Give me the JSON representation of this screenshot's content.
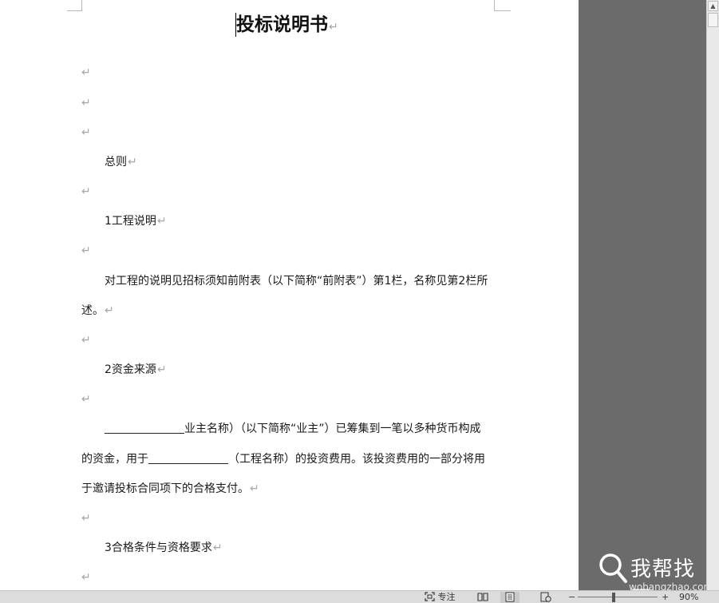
{
  "document": {
    "title": "投标说明书",
    "para_mark": "↵",
    "section_general": "总则",
    "item1_heading": "1工程说明",
    "item1_text_line1": "对工程的说明见招标须知前附表（以下简称“前附表”）第1栏，名称见第2栏所",
    "item1_text_line2": "述。",
    "item2_heading": "2资金来源",
    "item2_line1_suffix": "业主名称）（以下简称“业主”）已筹集到一笔以多种货币构成",
    "item2_line2_prefix": "的资金，用于",
    "item2_line2_suffix": "（工程名称）的投资费用。该投资费用的一部分将用",
    "item2_line3": "于邀请投标合同项下的合格支付。",
    "item3_heading": "3合格条件与资格要求"
  },
  "statusbar": {
    "focus_label": "专注",
    "zoom_level": "90%",
    "zoom_minus": "−",
    "zoom_plus": "+"
  },
  "watermark": {
    "brand": "我帮找网",
    "url": "wobangzhao.com"
  }
}
